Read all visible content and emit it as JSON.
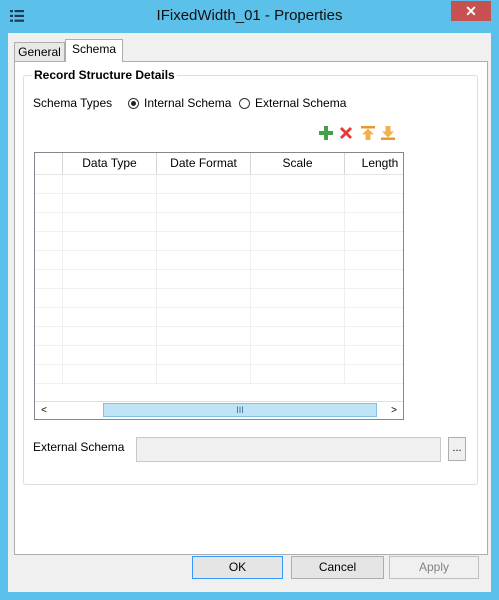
{
  "window": {
    "title": "IFixedWidth_01 - Properties",
    "title_bar_color": "#5bc0ea",
    "app_icon": "list-icon",
    "close_glyph": "✕"
  },
  "tabs": [
    {
      "label": "General",
      "active": false
    },
    {
      "label": "Schema",
      "active": true
    }
  ],
  "schema_tab": {
    "group_title": "Record Structure Details",
    "schema_types_label": "Schema Types",
    "options": [
      {
        "label": "Internal Schema",
        "checked": true
      },
      {
        "label": "External Schema",
        "checked": false
      }
    ],
    "toolbar": [
      {
        "icon": "add-icon",
        "color": "#43a047"
      },
      {
        "icon": "delete-icon",
        "color": "#e53935"
      },
      {
        "icon": "move-up-icon",
        "color": "#f0a030"
      },
      {
        "icon": "move-down-icon",
        "color": "#f0a030"
      }
    ],
    "grid": {
      "columns": [
        "",
        "Data Type",
        "Date Format",
        "Scale",
        "Length"
      ],
      "empty_rows": 11,
      "scroll_left_glyph": "<",
      "scroll_right_glyph": ">",
      "scroll_thumb_grip": "III"
    },
    "external_schema_label": "External Schema",
    "external_schema_value": "",
    "browse_label": "..."
  },
  "buttons": {
    "ok": "OK",
    "cancel": "Cancel",
    "apply": "Apply"
  }
}
